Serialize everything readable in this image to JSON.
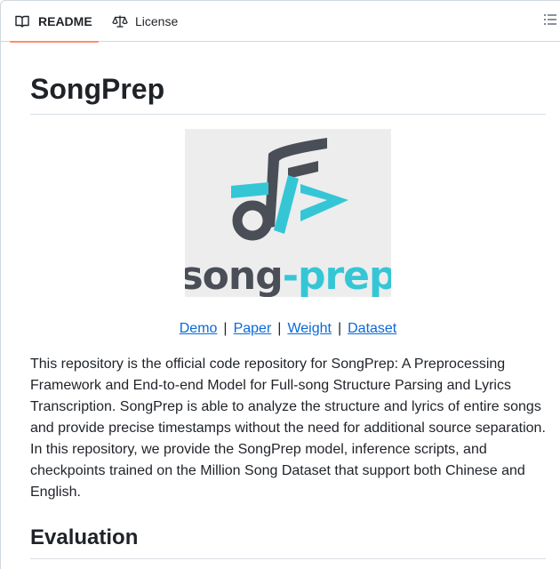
{
  "tabs": [
    {
      "label": "README",
      "icon": "book-icon",
      "active": true
    },
    {
      "label": "License",
      "icon": "scale-icon",
      "active": false
    }
  ],
  "outline_button": {
    "icon": "list-unordered-icon"
  },
  "readme": {
    "title": "SongPrep",
    "logo": {
      "wordmark": "song-prep",
      "colors": {
        "dark": "#4a4e57",
        "accent": "#35c6d6",
        "background": "#ededed"
      }
    },
    "links": [
      "Demo",
      "Paper",
      "Weight",
      "Dataset"
    ],
    "separator": "|",
    "description": "This repository is the official code repository for SongPrep: A Preprocessing Framework and End-to-end Model for Full-song Structure Parsing and Lyrics Transcription. SongPrep is able to analyze the structure and lyrics of entire songs and provide precise timestamps without the need for additional source separation. In this repository, we provide the SongPrep model, inference scripts, and checkpoints trained on the Million Song Dataset that support both Chinese and English.",
    "section_heading": "Evaluation"
  },
  "colors": {
    "link": "#0969da",
    "active_tab_underline": "#fd8c73",
    "text": "#1f2328",
    "border": "#d0d7de"
  }
}
